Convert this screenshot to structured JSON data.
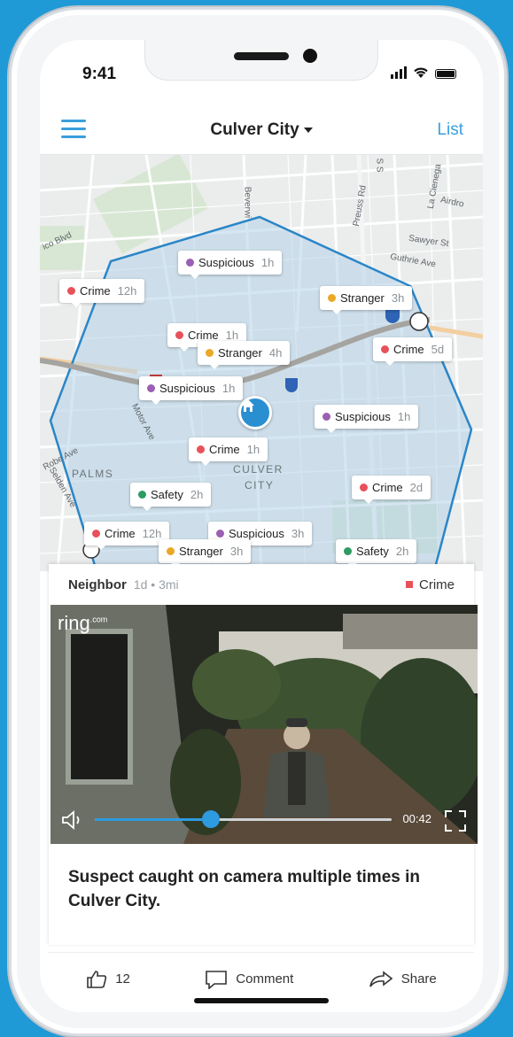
{
  "status_bar": {
    "time": "9:41"
  },
  "header": {
    "location": "Culver City",
    "list_label": "List"
  },
  "map": {
    "area_labels": [
      "PALMS",
      "CULVER",
      "CITY"
    ],
    "road_labels": [
      "Beverwi",
      "S S",
      "La Cienega",
      "Preuss Rd",
      "Sawyer St",
      "Guthrie Ave",
      "Airdro",
      "ico Blvd",
      "Motor Ave",
      "Robe Ave",
      "Selden Ave"
    ],
    "highway_shields": [
      "10",
      "187"
    ],
    "incidents": [
      {
        "category": "Suspicious",
        "age": "1h",
        "color": "#9b5fb3"
      },
      {
        "category": "Crime",
        "age": "12h",
        "color": "#e8515a"
      },
      {
        "category": "Stranger",
        "age": "3h",
        "color": "#e9a825"
      },
      {
        "category": "Crime",
        "age": "1h",
        "color": "#e8515a"
      },
      {
        "category": "Stranger",
        "age": "4h",
        "color": "#e9a825"
      },
      {
        "category": "Crime",
        "age": "5d",
        "color": "#e8515a"
      },
      {
        "category": "Suspicious",
        "age": "1h",
        "color": "#9b5fb3"
      },
      {
        "category": "Suspicious",
        "age": "1h",
        "color": "#9b5fb3"
      },
      {
        "category": "Crime",
        "age": "1h",
        "color": "#e8515a"
      },
      {
        "category": "Safety",
        "age": "2h",
        "color": "#2e9b63"
      },
      {
        "category": "Crime",
        "age": "2d",
        "color": "#e8515a"
      },
      {
        "category": "Crime",
        "age": "12h",
        "color": "#e8515a"
      },
      {
        "category": "Suspicious",
        "age": "3h",
        "color": "#9b5fb3"
      },
      {
        "category": "Stranger",
        "age": "3h",
        "color": "#e9a825"
      },
      {
        "category": "Safety",
        "age": "2h",
        "color": "#2e9b63"
      }
    ]
  },
  "post": {
    "author": "Neighbor",
    "meta": "1d • 3mi",
    "category": "Crime",
    "brand": "ring",
    "brand_suffix": ".com",
    "duration": "00:42",
    "progress": 0.39,
    "title": "Suspect caught on camera multiple times in Culver City."
  },
  "actions": {
    "like_count": "12",
    "comment_label": "Comment",
    "share_label": "Share"
  },
  "colors": {
    "accent": "#3a9fdc",
    "polygon": "#2a86c8"
  },
  "icons": [
    "menu-icon",
    "caret-down-icon",
    "home-icon",
    "volume-icon",
    "fullscreen-icon",
    "thumbs-up-icon",
    "comment-icon",
    "share-icon"
  ]
}
